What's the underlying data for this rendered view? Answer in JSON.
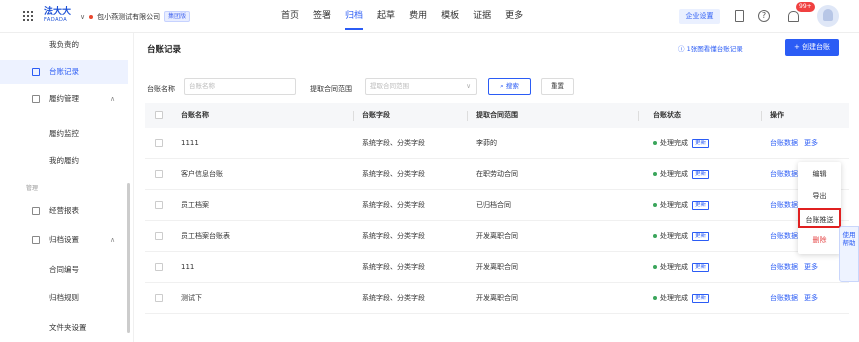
{
  "header": {
    "logo_cn": "法大大",
    "logo_en": "FADADA",
    "org_name": "包小燕测试有限公司",
    "org_tag": "集团版",
    "nav": [
      "首页",
      "签署",
      "归档",
      "起草",
      "费用",
      "模板",
      "证据",
      "更多"
    ],
    "active_nav": "归档",
    "enterprise_settings": "企业设置",
    "help_icon": "?",
    "notification_badge": "99+"
  },
  "sidebar": {
    "items": [
      {
        "label": "我负责的"
      },
      {
        "label": "台账记录"
      },
      {
        "label": "履约管理"
      },
      {
        "label": "履约监控"
      },
      {
        "label": "我的履约"
      },
      {
        "label": "管理"
      },
      {
        "label": "经营报表"
      },
      {
        "label": "归档设置"
      },
      {
        "label": "合同编号"
      },
      {
        "label": "归档规则"
      },
      {
        "label": "文件夹设置"
      }
    ]
  },
  "main": {
    "title": "台账记录",
    "view_link": "1张图看懂台账记录",
    "create_button": "+ 创建台账",
    "filters": {
      "name_label": "台账名称",
      "name_placeholder": "台账名称",
      "range_label": "提取合同范围",
      "range_placeholder": "提取合同范围",
      "search_button": "搜索",
      "reset_button": "重置"
    },
    "columns": [
      "台账名称",
      "台账字段",
      "提取合同范围",
      "台账状态",
      "操作"
    ],
    "rows": [
      {
        "name": "1111",
        "fields": "系统字段、分类字段",
        "range": "李茆的",
        "status": "处理完成",
        "tag": "更新",
        "op1": "台账数据",
        "op2": "更多"
      },
      {
        "name": "客户信息台账",
        "fields": "系统字段、分类字段",
        "range": "在职劳动合同",
        "status": "处理完成",
        "tag": "更新",
        "op1": "台账数据",
        "op2": ""
      },
      {
        "name": "员工档案",
        "fields": "系统字段、分类字段",
        "range": "已归档合同",
        "status": "处理完成",
        "tag": "更新",
        "op1": "台账数据",
        "op2": ""
      },
      {
        "name": "员工档案台账表",
        "fields": "系统字段、分类字段",
        "range": "开发离职合同",
        "status": "处理完成",
        "tag": "更新",
        "op1": "台账数据",
        "op2": ""
      },
      {
        "name": "111",
        "fields": "系统字段、分类字段",
        "range": "开发离职合同",
        "status": "处理完成",
        "tag": "更新",
        "op1": "台账数据",
        "op2": "更多"
      },
      {
        "name": "测试下",
        "fields": "系统字段、分类字段",
        "range": "开发离职合同",
        "status": "处理完成",
        "tag": "更新",
        "op1": "台账数据",
        "op2": "更多"
      }
    ]
  },
  "menu": {
    "items": [
      "编辑",
      "导出",
      "台账推送",
      "删除"
    ]
  },
  "float_help": "使用帮助",
  "colors": {
    "primary": "#2b5cf5",
    "danger": "#e54848",
    "success": "#3aa55b"
  }
}
